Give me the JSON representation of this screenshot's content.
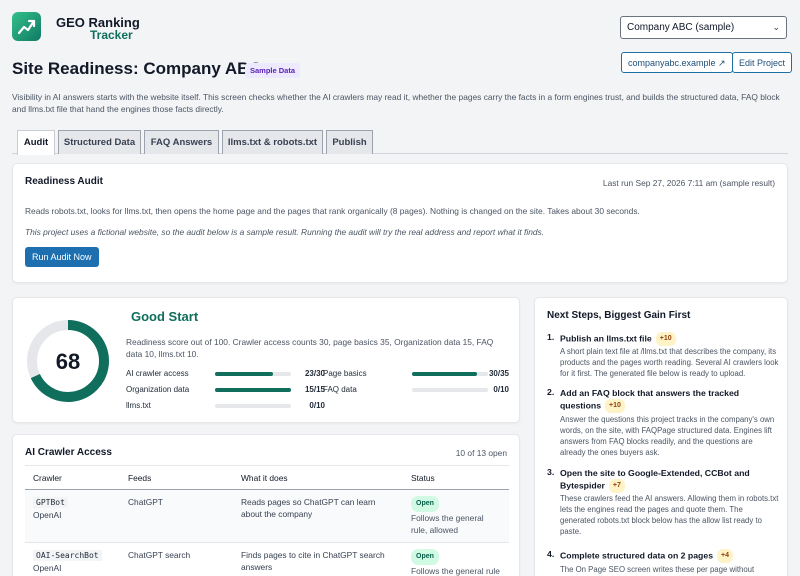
{
  "brand": {
    "line1": "GEO Ranking",
    "line2": "Tracker"
  },
  "project_select": {
    "value": "Company ABC (sample)"
  },
  "header": {
    "site_link": "companyabc.example ↗",
    "edit_button": "Edit Project",
    "title": "Site Readiness: Company ABC",
    "badge": "Sample Data",
    "intro": "Visibility in AI answers starts with the website itself. This screen checks whether the AI crawlers may read it, whether the pages carry the facts in a form engines trust, and builds the structured data, FAQ block and llms.txt file that hand the engines those facts directly."
  },
  "tabs": [
    {
      "label": "Audit",
      "active": true
    },
    {
      "label": "Structured Data"
    },
    {
      "label": "FAQ Answers"
    },
    {
      "label": "llms.txt & robots.txt"
    },
    {
      "label": "Publish"
    }
  ],
  "audit": {
    "heading": "Readiness Audit",
    "last_run": "Last run Sep 27, 2026 7:11 am (sample result)",
    "desc": "Reads robots.txt, looks for llms.txt, then opens the home page and the pages that rank organically (8 pages). Nothing is changed on the site. Takes about 30 seconds.",
    "note": "This project uses a fictional website, so the audit below is a sample result. Running the audit will try the real address and report what it finds.",
    "run_button": "Run Audit Now"
  },
  "score": {
    "value": "68",
    "value_num": 68,
    "max": 100,
    "verdict": "Good Start",
    "desc": "Readiness score out of 100. Crawler access counts 30, page basics 35, Organization data 15, FAQ data 10, llms.txt 10.",
    "metrics": [
      {
        "label": "AI crawler access",
        "value": "23/30",
        "fraction": 0.7667
      },
      {
        "label": "Page basics",
        "value": "30/35",
        "fraction": 0.857
      },
      {
        "label": "Organization data",
        "value": "15/15",
        "fraction": 1.0
      },
      {
        "label": "FAQ data",
        "value": "0/10",
        "fraction": 0
      },
      {
        "label": "llms.txt",
        "value": "0/10",
        "fraction": 0
      }
    ],
    "colors": {
      "accent": "#0f6e5c",
      "track": "#e5e7eb"
    }
  },
  "crawlers": {
    "heading": "AI Crawler Access",
    "count": "10 of 13 open",
    "columns": [
      "Crawler",
      "Feeds",
      "What it does",
      "Status"
    ],
    "rows": [
      {
        "name": "GPTBot",
        "owner": "OpenAI",
        "feeds": "ChatGPT",
        "what": "Reads pages so ChatGPT can learn about the company",
        "status": "Open",
        "note": "Follows the general rule, allowed"
      },
      {
        "name": "OAI-SearchBot",
        "owner": "OpenAI",
        "feeds": "ChatGPT search",
        "what": "Finds pages to cite in ChatGPT search answers",
        "status": "Open",
        "note": "Follows the general rule"
      }
    ]
  },
  "next_steps": {
    "heading": "Next Steps, Biggest Gain First",
    "items": [
      {
        "num": "1.",
        "title": "Publish an llms.txt file",
        "gain": "+10",
        "body": "A short plain text file at /llms.txt that describes the company, its products and the pages worth reading. Several AI crawlers look for it first. The generated file below is ready to upload."
      },
      {
        "num": "2.",
        "title": "Add an FAQ block that answers the tracked questions",
        "gain": "+10",
        "body": "Answer the questions this project tracks in the company's own words, on the site, with FAQPage structured data. Engines lift answers from FAQ blocks readily, and the questions are already the ones buyers ask."
      },
      {
        "num": "3.",
        "title": "Open the site to Google-Extended, CCBot and Bytespider",
        "gain": "+7",
        "body": "These crawlers feed the AI answers. Allowing them in robots.txt lets the engines read the pages and quote them. The generated robots.txt block below has the allow list ready to paste."
      },
      {
        "num": "4.",
        "title": "Complete structured data on 2 pages",
        "gain": "+4",
        "body": "The On Page SEO screen writes these per page without"
      }
    ]
  }
}
